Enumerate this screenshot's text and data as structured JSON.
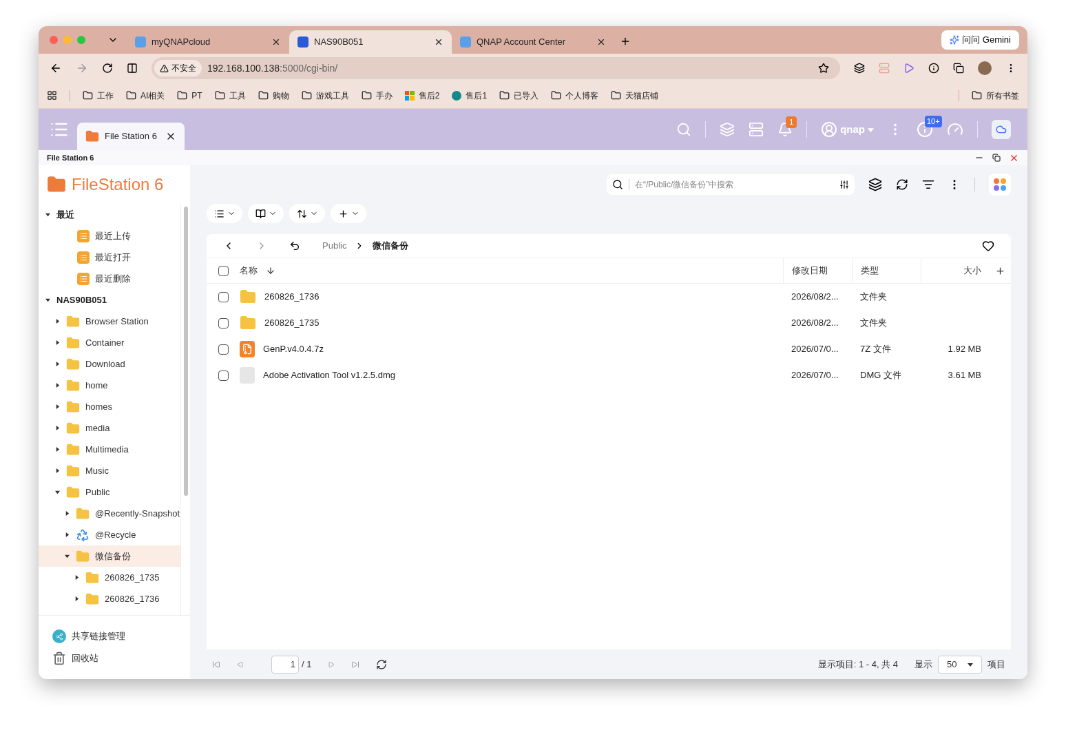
{
  "browser": {
    "tabs": [
      {
        "title": "myQNAPcloud",
        "selected": false
      },
      {
        "title": "NAS90B051",
        "selected": true
      },
      {
        "title": "QNAP Account Center",
        "selected": false
      }
    ],
    "gemini_button": "问问 Gemini",
    "address": {
      "security": "不安全",
      "host": "192.168.100.138",
      "path": ":5000/cgi-bin/"
    },
    "bookmarks": [
      {
        "label": "工作",
        "kind": "folder"
      },
      {
        "label": "AI相关",
        "kind": "folder"
      },
      {
        "label": "PT",
        "kind": "folder"
      },
      {
        "label": "工具",
        "kind": "folder"
      },
      {
        "label": "购物",
        "kind": "folder"
      },
      {
        "label": "游戏工具",
        "kind": "folder"
      },
      {
        "label": "手办",
        "kind": "folder"
      },
      {
        "label": "售后2",
        "kind": "tiles"
      },
      {
        "label": "售后1",
        "kind": "site"
      },
      {
        "label": "已导入",
        "kind": "folder"
      },
      {
        "label": "个人博客",
        "kind": "folder"
      },
      {
        "label": "天猫店铺",
        "kind": "folder"
      }
    ],
    "all_bookmarks": "所有书签"
  },
  "qnap": {
    "app_tab": "File Station 6",
    "notification_badge": "1",
    "user": "qnap",
    "update_badge": "10+"
  },
  "window": {
    "title": "File Station 6"
  },
  "sidebar": {
    "logo": "FileStation 6",
    "tree": [
      {
        "label": "最近",
        "kind": "section",
        "expanded": true,
        "selected": false,
        "children": [
          {
            "label": "最近上传",
            "kind": "recent",
            "selected": false
          },
          {
            "label": "最近打开",
            "kind": "recent",
            "selected": false
          },
          {
            "label": "最近删除",
            "kind": "recent",
            "selected": false
          }
        ]
      },
      {
        "label": "NAS90B051",
        "kind": "section",
        "expanded": true,
        "selected": false,
        "children": [
          {
            "label": "Browser Station",
            "kind": "folder",
            "expanded": false,
            "selected": false
          },
          {
            "label": "Container",
            "kind": "folder",
            "expanded": false,
            "selected": false
          },
          {
            "label": "Download",
            "kind": "folder",
            "expanded": false,
            "selected": false
          },
          {
            "label": "home",
            "kind": "folder",
            "expanded": false,
            "selected": false
          },
          {
            "label": "homes",
            "kind": "folder",
            "expanded": false,
            "selected": false
          },
          {
            "label": "media",
            "kind": "folder",
            "expanded": false,
            "selected": false
          },
          {
            "label": "Multimedia",
            "kind": "folder",
            "expanded": false,
            "selected": false
          },
          {
            "label": "Music",
            "kind": "folder",
            "expanded": false,
            "selected": false
          },
          {
            "label": "Public",
            "kind": "folder",
            "expanded": true,
            "selected": false,
            "children": [
              {
                "label": "@Recently-Snapshot",
                "kind": "folder",
                "expanded": false,
                "selected": false
              },
              {
                "label": "@Recycle",
                "kind": "recycle",
                "expanded": false,
                "selected": false
              },
              {
                "label": "微信备份",
                "kind": "folder",
                "expanded": true,
                "selected": true,
                "children": [
                  {
                    "label": "260826_1735",
                    "kind": "folder",
                    "expanded": false,
                    "selected": false
                  },
                  {
                    "label": "260826_1736",
                    "kind": "folder",
                    "expanded": false,
                    "selected": false
                  }
                ]
              }
            ]
          }
        ]
      }
    ],
    "footer": [
      {
        "label": "共享链接管理",
        "kind": "share"
      },
      {
        "label": "回收站",
        "kind": "trash"
      }
    ]
  },
  "search": {
    "placeholder": "在“/Public/微信备份”中搜索"
  },
  "breadcrumb": [
    "Public",
    "微信备份"
  ],
  "table": {
    "select_all": {
      "checked": false
    },
    "columns": [
      "名称",
      "修改日期",
      "类型",
      "大小"
    ],
    "rows": [
      {
        "name": "260826_1736",
        "date": "2026/08/2...",
        "type": "文件夹",
        "kind": "folder",
        "checked": false
      },
      {
        "name": "260826_1735",
        "date": "2026/08/2...",
        "type": "文件夹",
        "kind": "folder",
        "checked": false
      },
      {
        "name": "GenP.v4.0.4.7z",
        "date": "2026/07/0...",
        "type": "7Z 文件",
        "size": "1.92 MB",
        "kind": "archive",
        "checked": false
      },
      {
        "name": "Adobe Activation Tool v1.2.5.dmg",
        "date": "2026/07/0...",
        "type": "DMG 文件",
        "size": "3.61 MB",
        "kind": "file",
        "checked": false
      }
    ]
  },
  "pagination": {
    "page": "1",
    "total": "/ 1",
    "summary": "显示项目: 1 - 4, 共 4",
    "show_label": "显示",
    "per_page": "50",
    "unit": "项目"
  }
}
